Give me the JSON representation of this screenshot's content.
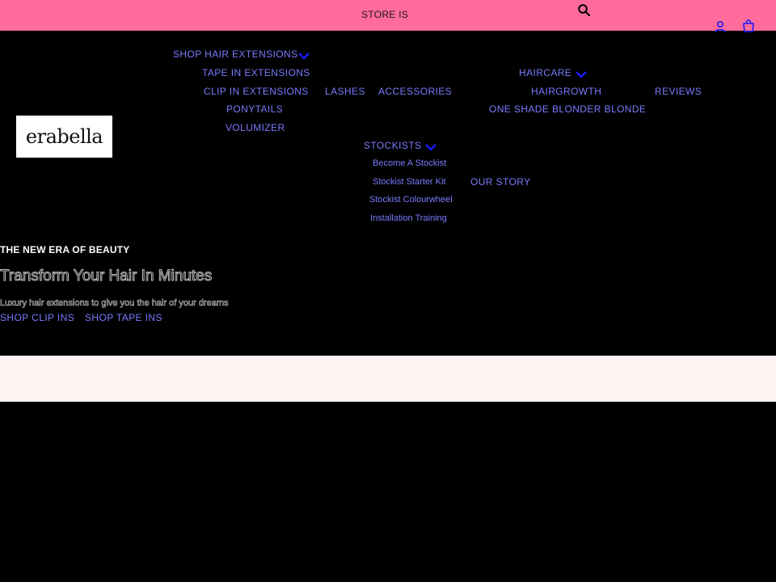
{
  "announcement": {
    "text": "STORE IS"
  },
  "header": {
    "icons": {
      "search": "search-icon",
      "account": "account-icon",
      "cart": "cart-icon"
    },
    "logo_text": "erabella"
  },
  "nav": {
    "shop_hair_extensions": {
      "label": "SHOP HAIR EXTENSIONS",
      "items": [
        "TAPE IN EXTENSIONS",
        "CLIP IN EXTENSIONS",
        "PONYTAILS",
        "VOLUMIZER"
      ]
    },
    "lashes": "LASHES",
    "accessories": "ACCESSORIES",
    "haircare": {
      "label": "HAIRCARE",
      "items": [
        "HAIRGROWTH",
        "ONE SHADE BLONDER BLONDE"
      ]
    },
    "reviews": "REVIEWS",
    "stockists": {
      "label": "STOCKISTS",
      "items": [
        "Become A Stockist",
        "Stockist Starter Kit",
        "Stockist Colourwheel",
        "Installation Training"
      ]
    },
    "our_story": "OUR STORY"
  },
  "hero": {
    "eyebrow": "THE NEW ERA OF BEAUTY",
    "title": "Transform Your Hair In Minutes",
    "subtitle": "Luxury hair extensions to give you the hair of your dreams",
    "buttons": [
      "SHOP CLIP INS",
      "SHOP TAPE INS"
    ]
  },
  "colors": {
    "announcement_bg": "#ff6b9a",
    "page_bg": "#000000",
    "link": "#7a7aff",
    "chevron": "#1a1aff",
    "band_bg": "#fff2f2"
  }
}
